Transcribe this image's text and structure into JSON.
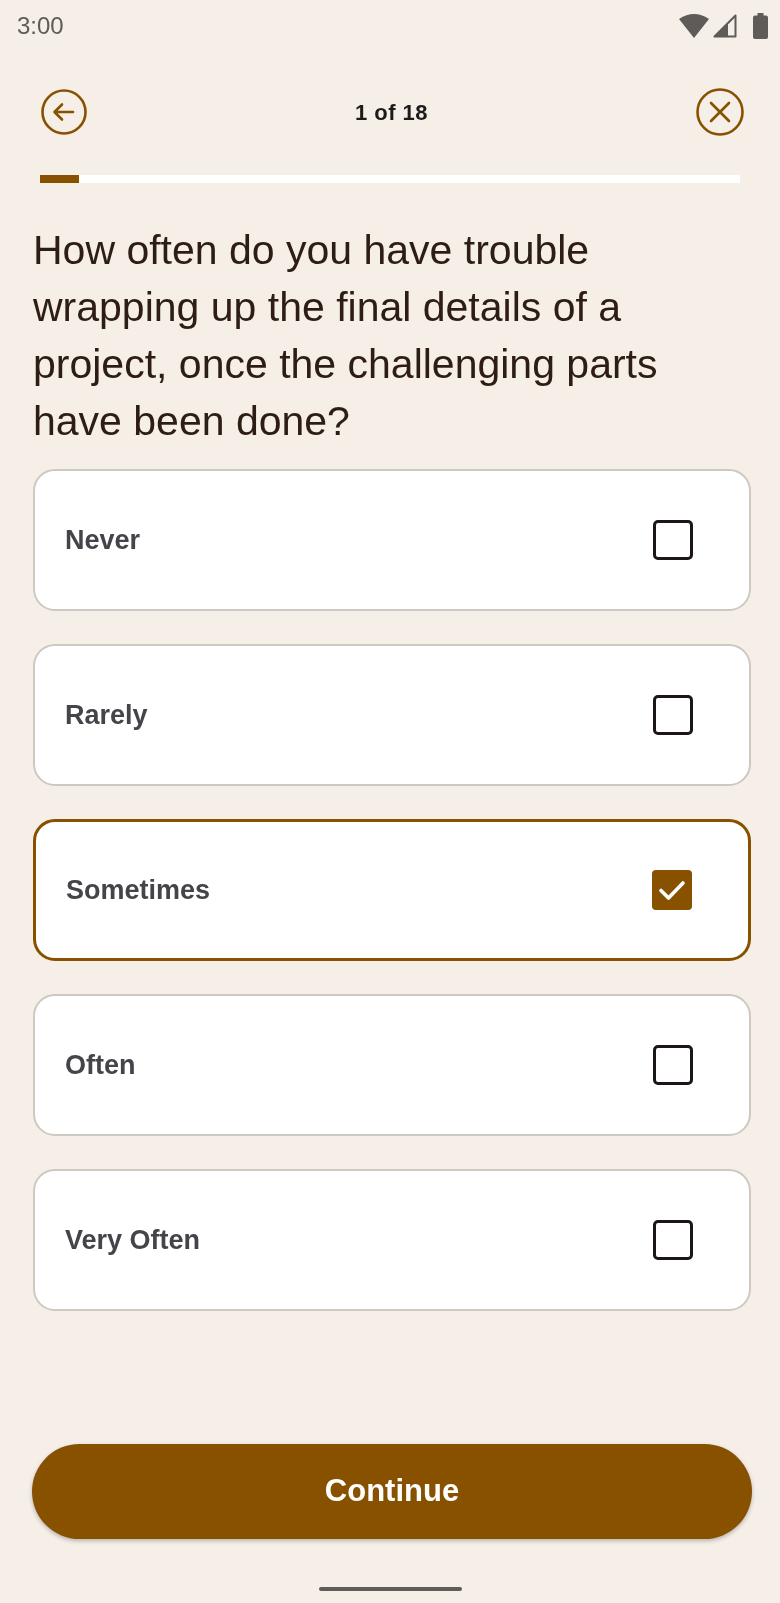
{
  "status_bar": {
    "time": "3:00"
  },
  "header": {
    "progress_label": "1 of 18"
  },
  "progress": {
    "level": 0.056
  },
  "question": "How often do you have trouble wrapping up the final details of a project, once the challenging parts have been done?",
  "options": [
    {
      "label": "Never",
      "selected": false
    },
    {
      "label": "Rarely",
      "selected": false
    },
    {
      "label": "Sometimes",
      "selected": true
    },
    {
      "label": "Often",
      "selected": false
    },
    {
      "label": "Very Often",
      "selected": false
    }
  ],
  "continue_button": {
    "label": "Continue"
  }
}
